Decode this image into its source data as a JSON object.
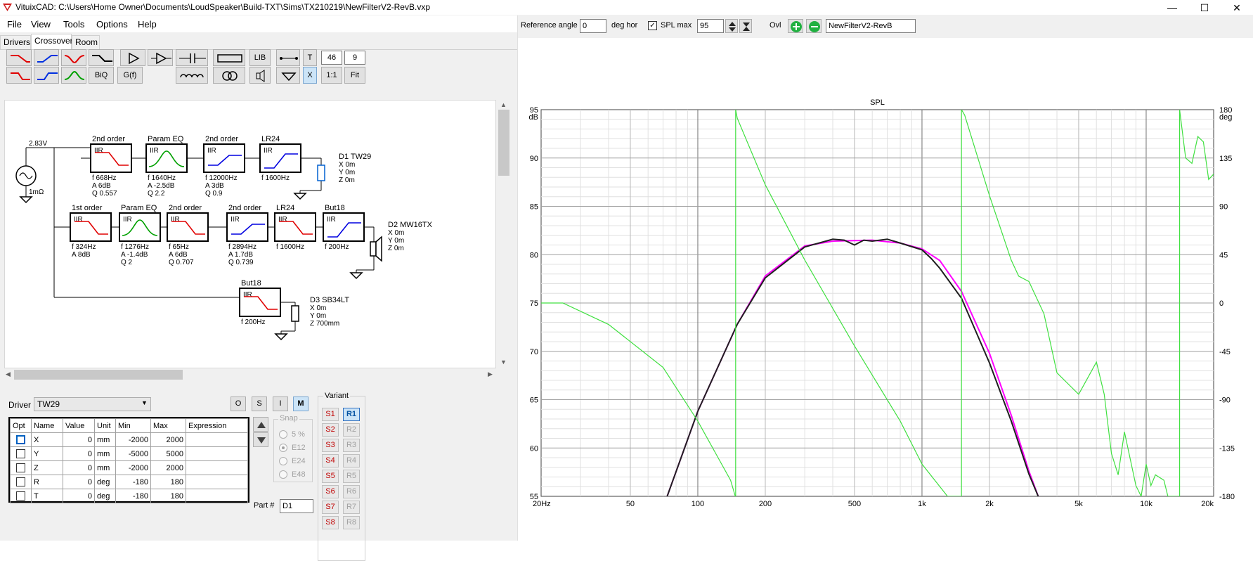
{
  "window": {
    "title": "VituixCAD: C:\\Users\\Home Owner\\Documents\\LoudSpeaker\\Build-TXT\\Sims\\TX210219\\NewFilterV2-RevB.vxp",
    "min": "—",
    "max": "☐",
    "close": "✕"
  },
  "menu": [
    "File",
    "View",
    "Tools",
    "Options",
    "Help"
  ],
  "tabs": [
    "Drivers",
    "Crossover",
    "Room"
  ],
  "toolbar": {
    "lib": "LIB",
    "t": "T",
    "num1": "46",
    "num2": "9",
    "biq": "BiQ",
    "gf": "G(f)",
    "x": "X",
    "ratio": "1:1",
    "fit": "Fit"
  },
  "schematic": {
    "source": {
      "voltage": "2.83V",
      "impedance": "1mΩ"
    },
    "blocks": [
      {
        "title": "2nd order",
        "type": "IIR",
        "params": [
          "f  668Hz",
          "A  6dB",
          "Q  0.557"
        ],
        "shape": "lp",
        "color": "#e00000"
      },
      {
        "title": "Param EQ",
        "type": "IIR",
        "params": [
          "f  1640Hz",
          "A  -2.5dB",
          "Q  2.2"
        ],
        "shape": "peq",
        "color": "#00a000"
      },
      {
        "title": "2nd order",
        "type": "IIR",
        "params": [
          "f  12000Hz",
          "A  3dB",
          "Q  0.9"
        ],
        "shape": "shelf",
        "color": "#0000e0"
      },
      {
        "title": "LR24",
        "type": "IIR",
        "params": [
          "f  1600Hz"
        ],
        "shape": "hp",
        "color": "#0000e0"
      },
      {
        "title": "1st order",
        "type": "IIR",
        "params": [
          "f  324Hz",
          "A  8dB"
        ],
        "shape": "lp",
        "color": "#e00000"
      },
      {
        "title": "Param EQ",
        "type": "IIR",
        "params": [
          "f  1276Hz",
          "A  -1.4dB",
          "Q  2"
        ],
        "shape": "peq",
        "color": "#00a000"
      },
      {
        "title": "2nd order",
        "type": "IIR",
        "params": [
          "f  65Hz",
          "A  6dB",
          "Q  0.707"
        ],
        "shape": "lp",
        "color": "#e00000"
      },
      {
        "title": "2nd order",
        "type": "IIR",
        "params": [
          "f  2894Hz",
          "A  1.7dB",
          "Q  0.739"
        ],
        "shape": "shelf",
        "color": "#0000e0"
      },
      {
        "title": "LR24",
        "type": "IIR",
        "params": [
          "f  1600Hz"
        ],
        "shape": "lp",
        "color": "#e00000"
      },
      {
        "title": "But18",
        "type": "IIR",
        "params": [
          "f  200Hz"
        ],
        "shape": "hp",
        "color": "#0000e0"
      },
      {
        "title": "But18",
        "type": "IIR",
        "params": [
          "f  200Hz"
        ],
        "shape": "lp",
        "color": "#e00000"
      }
    ],
    "drivers": [
      {
        "name": "D1 TW29",
        "lines": [
          "X 0m",
          "Y 0m",
          "Z 0m"
        ]
      },
      {
        "name": "D2 MW16TX",
        "lines": [
          "X 0m",
          "Y 0m",
          "Z 0m"
        ]
      },
      {
        "name": "D3 SB34LT",
        "lines": [
          "X 0m",
          "Y 0m",
          "Z 700mm"
        ]
      }
    ]
  },
  "driver_panel": {
    "label": "Driver",
    "selected": "TW29",
    "mode_buttons": [
      "O",
      "S",
      "I",
      "M"
    ],
    "active_mode": "M",
    "columns": [
      "Opt",
      "Name",
      "Value",
      "Unit",
      "Min",
      "Max",
      "Expression"
    ],
    "rows": [
      [
        "X",
        "0",
        "mm",
        "-2000",
        "2000",
        ""
      ],
      [
        "Y",
        "0",
        "mm",
        "-5000",
        "5000",
        ""
      ],
      [
        "Z",
        "0",
        "mm",
        "-2000",
        "2000",
        ""
      ],
      [
        "R",
        "0",
        "deg",
        "-180",
        "180",
        ""
      ],
      [
        "T",
        "0",
        "deg",
        "-180",
        "180",
        ""
      ]
    ],
    "snap": {
      "label": "Snap",
      "options": [
        "5 %",
        "E12",
        "E24",
        "E48"
      ],
      "selected": "E12"
    },
    "part_label": "Part #",
    "part_value": "D1",
    "variant": {
      "label": "Variant",
      "s": [
        "S1",
        "S2",
        "S3",
        "S4",
        "S5",
        "S6",
        "S7",
        "S8"
      ],
      "r": [
        "R1",
        "R2",
        "R3",
        "R4",
        "R5",
        "R6",
        "R7",
        "R8"
      ],
      "active": "R1"
    }
  },
  "right_toolbar": {
    "ref_angle_label": "Reference angle",
    "ref_angle": "0",
    "ref_unit": "deg hor",
    "spl_max_label": "SPL max",
    "spl_max": "95",
    "ovl_label": "Ovl",
    "ovl_name": "NewFilterV2-RevB"
  },
  "chart_data": {
    "type": "line",
    "title": "SPL",
    "x_scale": "log",
    "xlim": [
      20,
      20000
    ],
    "x_ticks": [
      "20Hz",
      "50",
      "100",
      "200",
      "500",
      "1k",
      "2k",
      "5k",
      "10k",
      "20k"
    ],
    "ylim": [
      55,
      95
    ],
    "ylabel": "dB",
    "y_ticks": [
      "95",
      "90",
      "85",
      "80",
      "75",
      "70",
      "65",
      "60",
      "55"
    ],
    "y2lim": [
      -180,
      180
    ],
    "y2label": "deg",
    "y2_ticks": [
      "180",
      "135",
      "90",
      "45",
      "0",
      "-45",
      "-90",
      "-135",
      "-180"
    ],
    "grid": true,
    "series": [
      {
        "color": "#ff00ff",
        "axis": "left",
        "x": [
          73,
          100,
          150,
          200,
          300,
          400,
          600,
          800,
          1000,
          1200,
          1500,
          2000,
          2500,
          3000,
          3300
        ],
        "y": [
          55,
          63.8,
          72.8,
          77.8,
          80.9,
          81.4,
          81.5,
          81.2,
          80.6,
          79.4,
          76.2,
          69.8,
          63.4,
          57.6,
          55
        ]
      },
      {
        "color": "#202020",
        "axis": "left",
        "x": [
          73,
          100,
          150,
          200,
          300,
          400,
          450,
          500,
          550,
          600,
          700,
          800,
          1000,
          1100,
          1200,
          1500,
          2000,
          2500,
          3000,
          3300
        ],
        "y": [
          55,
          63.8,
          72.8,
          77.6,
          80.8,
          81.6,
          81.5,
          81.0,
          81.5,
          81.4,
          81.6,
          81.2,
          80.5,
          79.6,
          78.6,
          75.5,
          68.8,
          62.8,
          57.3,
          55
        ]
      },
      {
        "color": "#40e040",
        "axis": "right",
        "x": [
          20,
          25,
          40,
          70,
          100,
          140,
          147,
          147.5,
          150,
          200,
          300,
          500,
          800,
          1000,
          1300,
          1450,
          1490,
          1500,
          1550,
          2000,
          2500,
          2700,
          3000,
          3500,
          4000,
          5000,
          6000,
          6500,
          7000,
          7500,
          8000,
          9000,
          9500,
          10000,
          10500,
          11000,
          12000,
          12500,
          13500,
          14000,
          14100,
          15000,
          16000,
          17000,
          18000,
          19000,
          20000
        ],
        "y": [
          0,
          0,
          -20,
          -60,
          -110,
          -165,
          -180,
          180,
          172,
          110,
          40,
          -40,
          -110,
          -150,
          -180,
          -180,
          -180,
          180,
          175,
          100,
          40,
          25,
          20,
          -10,
          -65,
          -85,
          -55,
          -85,
          -140,
          -160,
          -120,
          -170,
          -180,
          -150,
          -170,
          -160,
          -165,
          -180,
          -180,
          -180,
          180,
          135,
          130,
          155,
          150,
          115,
          120
        ]
      }
    ]
  }
}
